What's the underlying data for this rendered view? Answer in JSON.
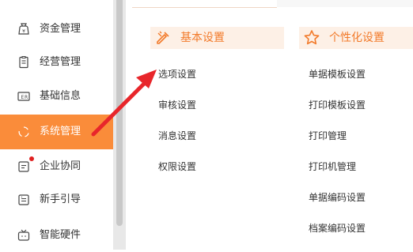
{
  "sidebar": {
    "items": [
      {
        "label": "资金管理",
        "icon": "money-bag-icon"
      },
      {
        "label": "经营管理",
        "icon": "clipboard-icon"
      },
      {
        "label": "基础信息",
        "icon": "id-card-icon"
      },
      {
        "label": "系统管理",
        "icon": "system-cycle-icon",
        "active": true
      },
      {
        "label": "企业协同",
        "icon": "collaboration-icon",
        "badge": true
      },
      {
        "label": "新手引导",
        "icon": "guide-icon"
      },
      {
        "label": "智能硬件",
        "icon": "hardware-tv-icon"
      }
    ]
  },
  "menu": {
    "basic": {
      "title": "基本设置",
      "icon": "tools-icon",
      "items": [
        "选项设置",
        "审核设置",
        "消息设置",
        "权限设置"
      ]
    },
    "personal": {
      "title": "个性化设置",
      "icon": "star-icon",
      "items": [
        "单据模板设置",
        "打印模板设置",
        "打印管理",
        "打印机管理",
        "单据编码设置",
        "档案编码设置"
      ]
    }
  },
  "colors": {
    "accent": "#fa8c3a",
    "category_bg": "#fdf0e6",
    "category_text": "#f27a2a",
    "badge": "#e02020",
    "annotation_arrow": "#e8262b"
  }
}
